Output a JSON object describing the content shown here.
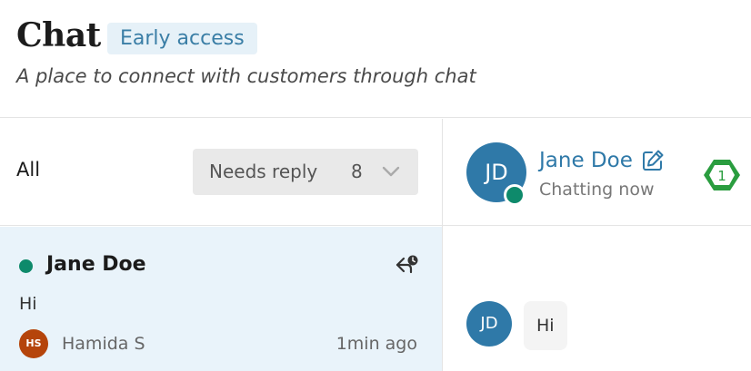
{
  "header": {
    "title": "Chat",
    "badge": "Early access",
    "subtitle": "A place to connect with customers through chat"
  },
  "filter": {
    "all_label": "All",
    "select_label": "Needs reply",
    "select_count": "8"
  },
  "conversation": {
    "customer_name": "Jane Doe",
    "last_message": "Hi",
    "agent_initials": "HS",
    "agent_name": "Hamida S",
    "time": "1min ago"
  },
  "contact": {
    "initials": "JD",
    "name": "Jane Doe",
    "status": "Chatting now",
    "badge_count": "1"
  },
  "chat": {
    "avatar_initials": "JD",
    "message": "Hi"
  },
  "colors": {
    "accent": "#2f79a8",
    "online": "#0e8a6b",
    "badge_green": "#2a9d3f",
    "selected_row": "#e9f3fa"
  }
}
